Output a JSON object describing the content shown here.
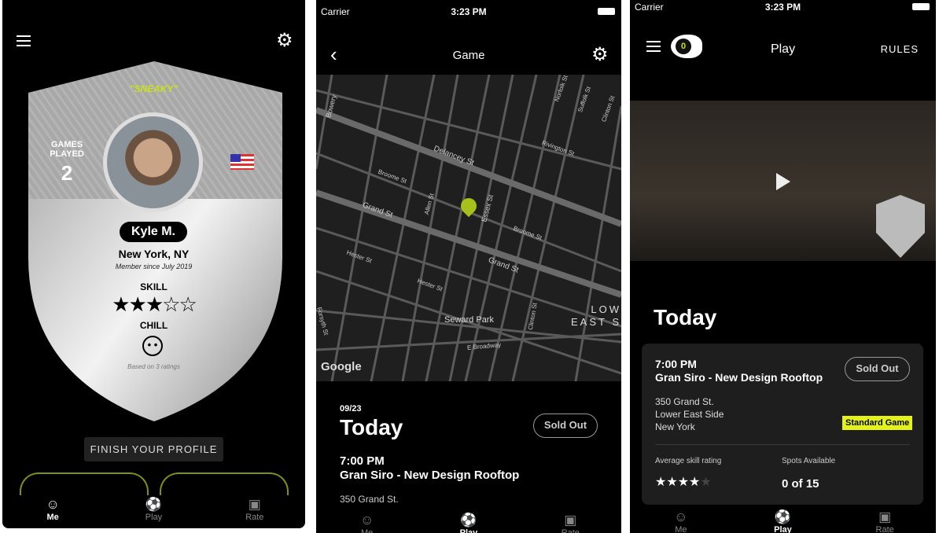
{
  "status": {
    "carrier": "Carrier",
    "time": "3:23 PM"
  },
  "me": {
    "nickname": "\"SNEAKY\"",
    "games_played_label": "GAMES PLAYED",
    "games_played": "2",
    "name": "Kyle M.",
    "location": "New York, NY",
    "member_since": "Member since July 2019",
    "skill_label": "SKILL",
    "skill_rating": 3,
    "skill_max": 5,
    "chill_label": "CHILL",
    "chill_icon": "neutral-face-icon",
    "ratings_note": "Based on 3 ratings",
    "finish_profile": "FINISH YOUR PROFILE",
    "accent": "#c8e21a"
  },
  "tabs": [
    {
      "label": "Me",
      "icon": "person-icon"
    },
    {
      "label": "Play",
      "icon": "soccer-ball-icon"
    },
    {
      "label": "Rate",
      "icon": "field-icon"
    }
  ],
  "game": {
    "title": "Game",
    "map": {
      "streets": [
        "Bowery",
        "Delancey St",
        "Broome St",
        "Allen St",
        "Grand St",
        "Essex St",
        "Broome St",
        "Grand St",
        "Hester St",
        "Hester St",
        "Rivington St",
        "Norfolk St",
        "Suffolk St",
        "Clinton St",
        "Clinton St",
        "Seward Park",
        "E Broadway",
        "Forsyth St"
      ],
      "area": "LOWER EAST SIDE",
      "area_visible": "LOW\nEAST S",
      "provider": "Google"
    },
    "date": "09/23",
    "day": "Today",
    "sold_out": "Sold Out",
    "time": "7:00 PM",
    "venue": "Gran Siro - New Design Rooftop",
    "address": "350 Grand St."
  },
  "play": {
    "title": "Play",
    "rules": "RULES",
    "coins": "0",
    "day": "Today",
    "card": {
      "time": "7:00 PM",
      "venue": "Gran Siro - New Design Rooftop",
      "sold_out": "Sold Out",
      "address1": "350 Grand St.",
      "address2": "Lower East Side",
      "address3": "New York",
      "game_type": "Standard Game",
      "avg_skill_label": "Average skill rating",
      "avg_skill": 4,
      "avg_skill_max": 5,
      "spots_label": "Spots Available",
      "spots": "0 of 15"
    }
  }
}
